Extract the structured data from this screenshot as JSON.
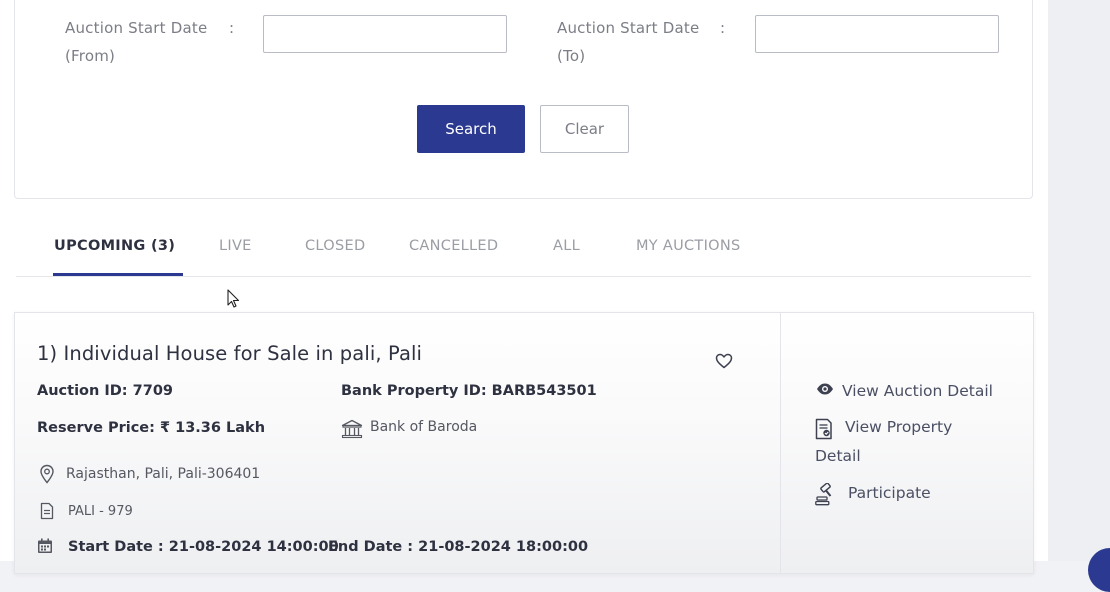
{
  "search": {
    "from_label_line1": "Auction Start Date",
    "from_label_line2": "(From)",
    "to_label_line1": "Auction Start Date",
    "to_label_line2": "(To)",
    "colon": ":",
    "from_value": "",
    "to_value": "",
    "search_button": "Search",
    "clear_button": "Clear"
  },
  "tabs": [
    {
      "label": "UPCOMING (3)",
      "active": true
    },
    {
      "label": "LIVE",
      "active": false
    },
    {
      "label": "CLOSED",
      "active": false
    },
    {
      "label": "CANCELLED",
      "active": false
    },
    {
      "label": "ALL",
      "active": false
    },
    {
      "label": "MY AUCTIONS",
      "active": false
    }
  ],
  "listing": {
    "title": "1) Individual House for Sale in pali, Pali",
    "auction_id": "Auction ID: 7709",
    "bank_property_id": "Bank Property ID: BARB543501",
    "reserve_price": "Reserve Price: ₹ 13.36 Lakh",
    "bank_name": "Bank of Baroda",
    "location": "Rajasthan, Pali, Pali-306401",
    "reference": "PALI - 979",
    "start_date": "Start Date : 21-08-2024 14:00:00",
    "end_date": "End Date : 21-08-2024 18:00:00",
    "actions": {
      "view_auction_detail": "View Auction Detail",
      "view_property_line1": "View Property",
      "view_property_line2": "Detail",
      "participate": "Participate"
    }
  },
  "icons": [
    "heart-icon",
    "eye-icon",
    "document-icon",
    "gavel-icon",
    "bank-icon",
    "location-pin-icon",
    "file-icon",
    "calendar-icon",
    "cursor-arrow-icon"
  ],
  "colors": {
    "primary": "#2b3990",
    "text_dark": "#2e3140",
    "text_muted": "#9a9da4"
  }
}
